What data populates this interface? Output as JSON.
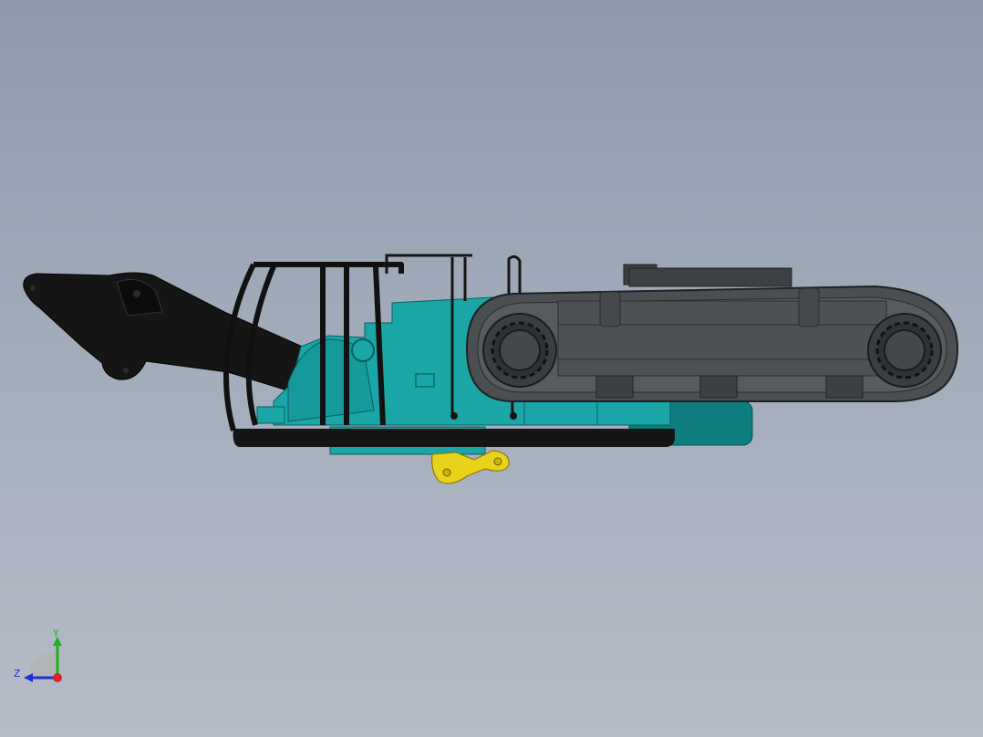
{
  "viewport": {
    "background_top": "#8e9aab",
    "background_bottom": "#b6bcc7"
  },
  "model": {
    "colors": {
      "body": "#1aa6a6",
      "body_dark": "#0e7d7e",
      "boom": "#141414",
      "track": "#4b4f52",
      "track_dark": "#2f3235",
      "hook": "#e8d21c"
    }
  },
  "triad": {
    "x_label": "",
    "y_label": "Y",
    "z_label": "Z",
    "x_color": "#e0202a",
    "y_color": "#20b020",
    "z_color": "#2030d0"
  }
}
